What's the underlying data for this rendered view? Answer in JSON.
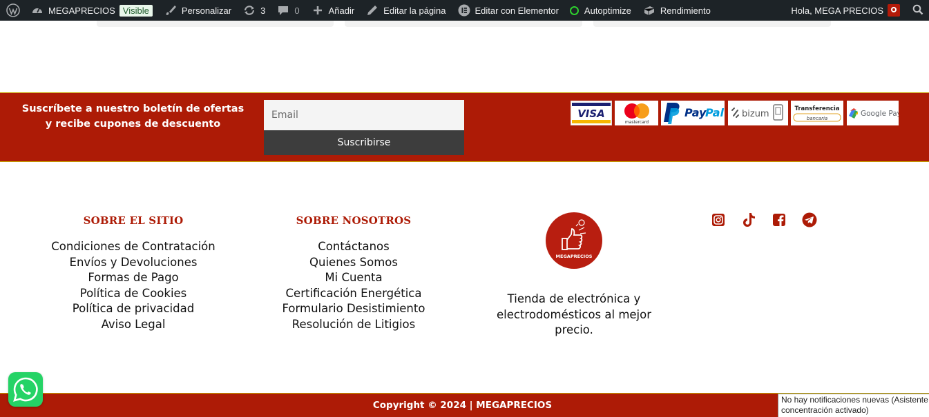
{
  "admin_bar": {
    "site_name": "MEGAPRECIOS",
    "visible_badge": "Visible",
    "customize": "Personalizar",
    "updates_count": "3",
    "comments_count": "0",
    "add_new": "Añadir",
    "edit_page": "Editar la página",
    "edit_elementor": "Editar con Elementor",
    "autoptimize": "Autoptimize",
    "performance": "Rendimiento",
    "greeting": "Hola, MEGA PRECIOS"
  },
  "newsletter": {
    "text_line1": "Suscríbete a nuestro boletín de ofertas",
    "text_line2": "y recibe cupones de descuento",
    "email_placeholder": "Email",
    "submit_label": "Suscribirse",
    "payment_methods": [
      "VISA",
      "mastercard",
      "PayPal",
      "bizum",
      "Transferencia bancaria",
      "Google Pay"
    ],
    "payment_labels": {
      "visa": "VISA",
      "mastercard": "mastercard",
      "paypal_pay": "Pay",
      "paypal_pal": "Pal",
      "bizum": "bizum",
      "transfer_top": "Transferencia",
      "transfer_bottom": "bancaria",
      "gpay": "Google Pay"
    }
  },
  "footer": {
    "about_site": {
      "title": "SOBRE EL SITIO",
      "links": [
        "Condiciones de Contratación",
        "Envíos y Devoluciones",
        "Formas de Pago",
        "Política de Cookies",
        "Política de privacidad",
        "Aviso Legal"
      ]
    },
    "about_us": {
      "title": "SOBRE NOSOTROS",
      "links": [
        "Contáctanos",
        "Quienes Somos",
        "Mi Cuenta",
        "Certificación Energética",
        "Formulario Desistimiento",
        "Resolución de Litigios"
      ]
    },
    "logo_text": "MEGAPRECIOS",
    "tagline": "Tienda de electrónica y electrodomésticos al mejor precio.",
    "social": [
      "instagram-icon",
      "tiktok-icon",
      "facebook-icon",
      "telegram-icon"
    ]
  },
  "copyright": "Copyright © 2024 | MEGAPRECIOS",
  "notification": {
    "line1": "No hay notificaciones nuevas (Asistente d",
    "line2": "concentración activado)"
  },
  "colors": {
    "brand_red": "#ad1b06",
    "admin_bar": "#1d2327",
    "button_dark": "#3d3d3d",
    "whatsapp_green": "#25d366"
  }
}
